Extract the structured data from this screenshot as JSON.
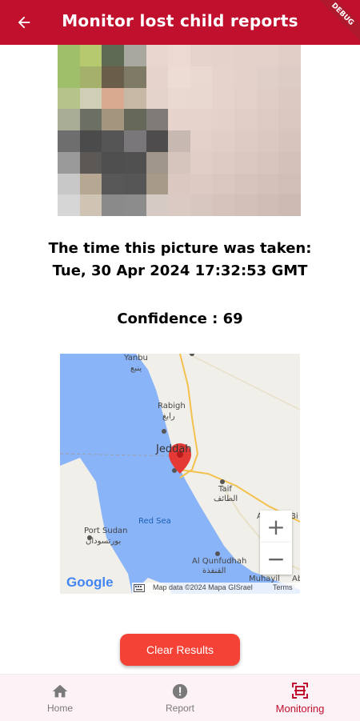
{
  "appbar": {
    "title": "Monitor lost child reports",
    "debug_banner": "DEBUG"
  },
  "report": {
    "time_label": "The time this picture was taken:",
    "time_value": "Tue, 30 Apr 2024 17:32:53 GMT",
    "confidence_label": "Confidence : 69"
  },
  "map": {
    "labels": {
      "yanbu": "Yanbu",
      "yanbu_ar": "ينبع",
      "rabigh": "Rabigh",
      "rabigh_ar": "رابغ",
      "jeddah": "Jeddah",
      "taif": "Taif",
      "taif_ar": "الطائف",
      "red_sea": "Red Sea",
      "port_sudan": "Port Sudan",
      "port_sudan_ar": "بورتسودان",
      "al_qunfudhah": "Al Qunfudhah",
      "al_qunfudhah_ar": "القنفذة",
      "al_ba": "Al B",
      "bi": "Bi",
      "muhayil": "Muhayil",
      "ab": "Ab"
    },
    "zoom_in": "+",
    "zoom_out": "−",
    "google_logo": "Google",
    "attribution": "Map data ©2024 Mapa GISrael",
    "terms": "Terms"
  },
  "actions": {
    "clear_results": "Clear Results"
  },
  "nav": {
    "items": [
      {
        "label": "Home",
        "icon": "home-icon"
      },
      {
        "label": "Report",
        "icon": "alert-icon"
      },
      {
        "label": "Monitoring",
        "icon": "scan-icon"
      }
    ],
    "active": "Monitoring",
    "active_color": "#c0102e"
  },
  "colors": {
    "appbar": "#c0102e",
    "button": "#f44336",
    "sea": "#8ab4f8",
    "land": "#f1efe9"
  }
}
